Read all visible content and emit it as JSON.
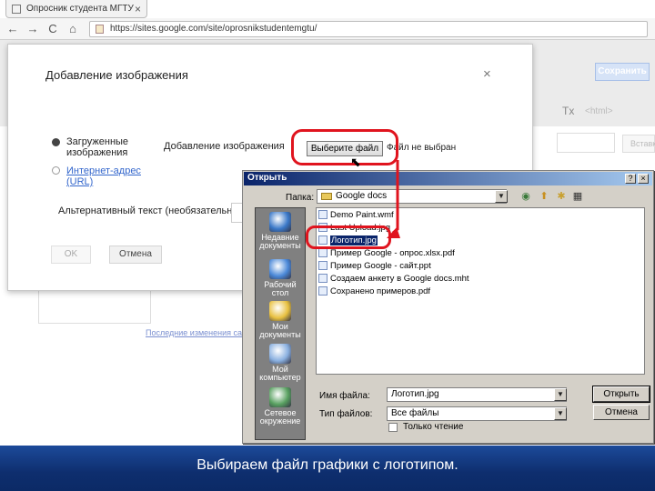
{
  "browser": {
    "tab_title": "Опросник студента МГТУ",
    "url": "https://sites.google.com/site/oprosnikstudentemgtu/",
    "nav": {
      "back": "←",
      "forward": "→",
      "reload": "C",
      "home": "⌂"
    },
    "tab_close": "×"
  },
  "page": {
    "save_label": "Сохранить",
    "tx_icon": "Tx",
    "style_label": "<html>",
    "right_button": "Вставк",
    "edit_link": "Последние изменения сайта"
  },
  "dialog": {
    "title": "Добавление изображения",
    "close": "×",
    "option_uploaded": "Загруженные изображения",
    "option_url": "Интернет-адрес (URL)",
    "add_image_label": "Добавление изображения",
    "choose_file_button": "Выберите файл",
    "no_file_text": "Файл не выбран",
    "alt_text_label": "Альтернативный текст (необязательно)",
    "ok_button": "OK",
    "cancel_button": "Отмена"
  },
  "open_dialog": {
    "title": "Открыть",
    "folder_label": "Папка:",
    "folder_value": "Google docs",
    "places": [
      {
        "label": "Недавние документы",
        "icon": "recent-docs-icon",
        "color": "#3a78c8"
      },
      {
        "label": "Рабочий стол",
        "icon": "desktop-icon",
        "color": "#4a88d8"
      },
      {
        "label": "Мои документы",
        "icon": "my-documents-icon",
        "color": "#e8c040"
      },
      {
        "label": "Мой компьютер",
        "icon": "my-computer-icon",
        "color": "#8ab0e0"
      },
      {
        "label": "Сетевое окружение",
        "icon": "network-icon",
        "color": "#58a060"
      }
    ],
    "files": [
      {
        "name": "Demo Paint.wmf",
        "selected": false
      },
      {
        "name": "Last Upload.jpg",
        "selected": false
      },
      {
        "name": "Логотип.jpg",
        "selected": true
      },
      {
        "name": "Пример Google - опрос.xlsx.pdf",
        "selected": false
      },
      {
        "name": "Пример Google - сайт.ppt",
        "selected": false
      },
      {
        "name": "Создаем анкету в Google doсs.mht",
        "selected": false
      },
      {
        "name": "Сохранено примеров.pdf",
        "selected": false
      }
    ],
    "filename_label": "Имя файла:",
    "filename_value": "Логотип.jpg",
    "filetype_label": "Тип файлов:",
    "filetype_value": "Все файлы",
    "readonly_label": "Только чтение",
    "open_button": "Открыть",
    "cancel_button": "Отмена"
  },
  "caption": "Выбираем файл графики с логотипом.",
  "colors": {
    "annotation_red": "#e0141e",
    "caption_band": "#0e2e6e",
    "win_title": "#0a246a"
  }
}
